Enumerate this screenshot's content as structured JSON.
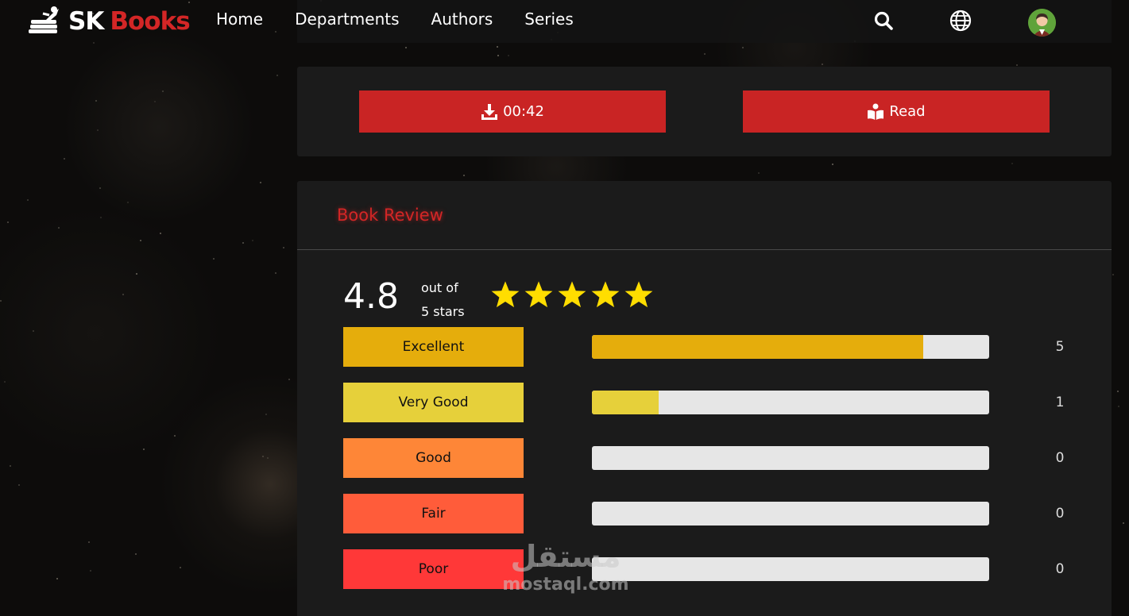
{
  "brand": {
    "part1": "SK",
    "part2": "Books"
  },
  "nav": {
    "items": [
      {
        "label": "Home"
      },
      {
        "label": "Departments"
      },
      {
        "label": "Authors"
      },
      {
        "label": "Series"
      }
    ]
  },
  "header_icons": [
    "search-icon",
    "globe-icon",
    "avatar"
  ],
  "actions": {
    "download_label": "00:42",
    "read_label": "Read"
  },
  "review": {
    "title": "Book Review",
    "rating": "4.8",
    "out_of_line1": "out of",
    "out_of_line2": "5 stars",
    "stars_filled": 5,
    "rows": [
      {
        "label": "Excellent",
        "count": "5",
        "fraction": 0.834,
        "color": "#e5ad0c"
      },
      {
        "label": "Very Good",
        "count": "1",
        "fraction": 0.167,
        "color": "#e6d03a"
      },
      {
        "label": "Good",
        "count": "0",
        "fraction": 0,
        "color": "#fe8637"
      },
      {
        "label": "Fair",
        "count": "0",
        "fraction": 0,
        "color": "#ff5c3a"
      },
      {
        "label": "Poor",
        "count": "0",
        "fraction": 0,
        "color": "#ff3838"
      }
    ]
  },
  "watermark": {
    "arabic": "مستقل",
    "latin": "mostaql.com"
  },
  "colors": {
    "accent": "#d32626",
    "button": "#c92424",
    "panel": "#1b1b1b",
    "star": "#ffdd00"
  }
}
